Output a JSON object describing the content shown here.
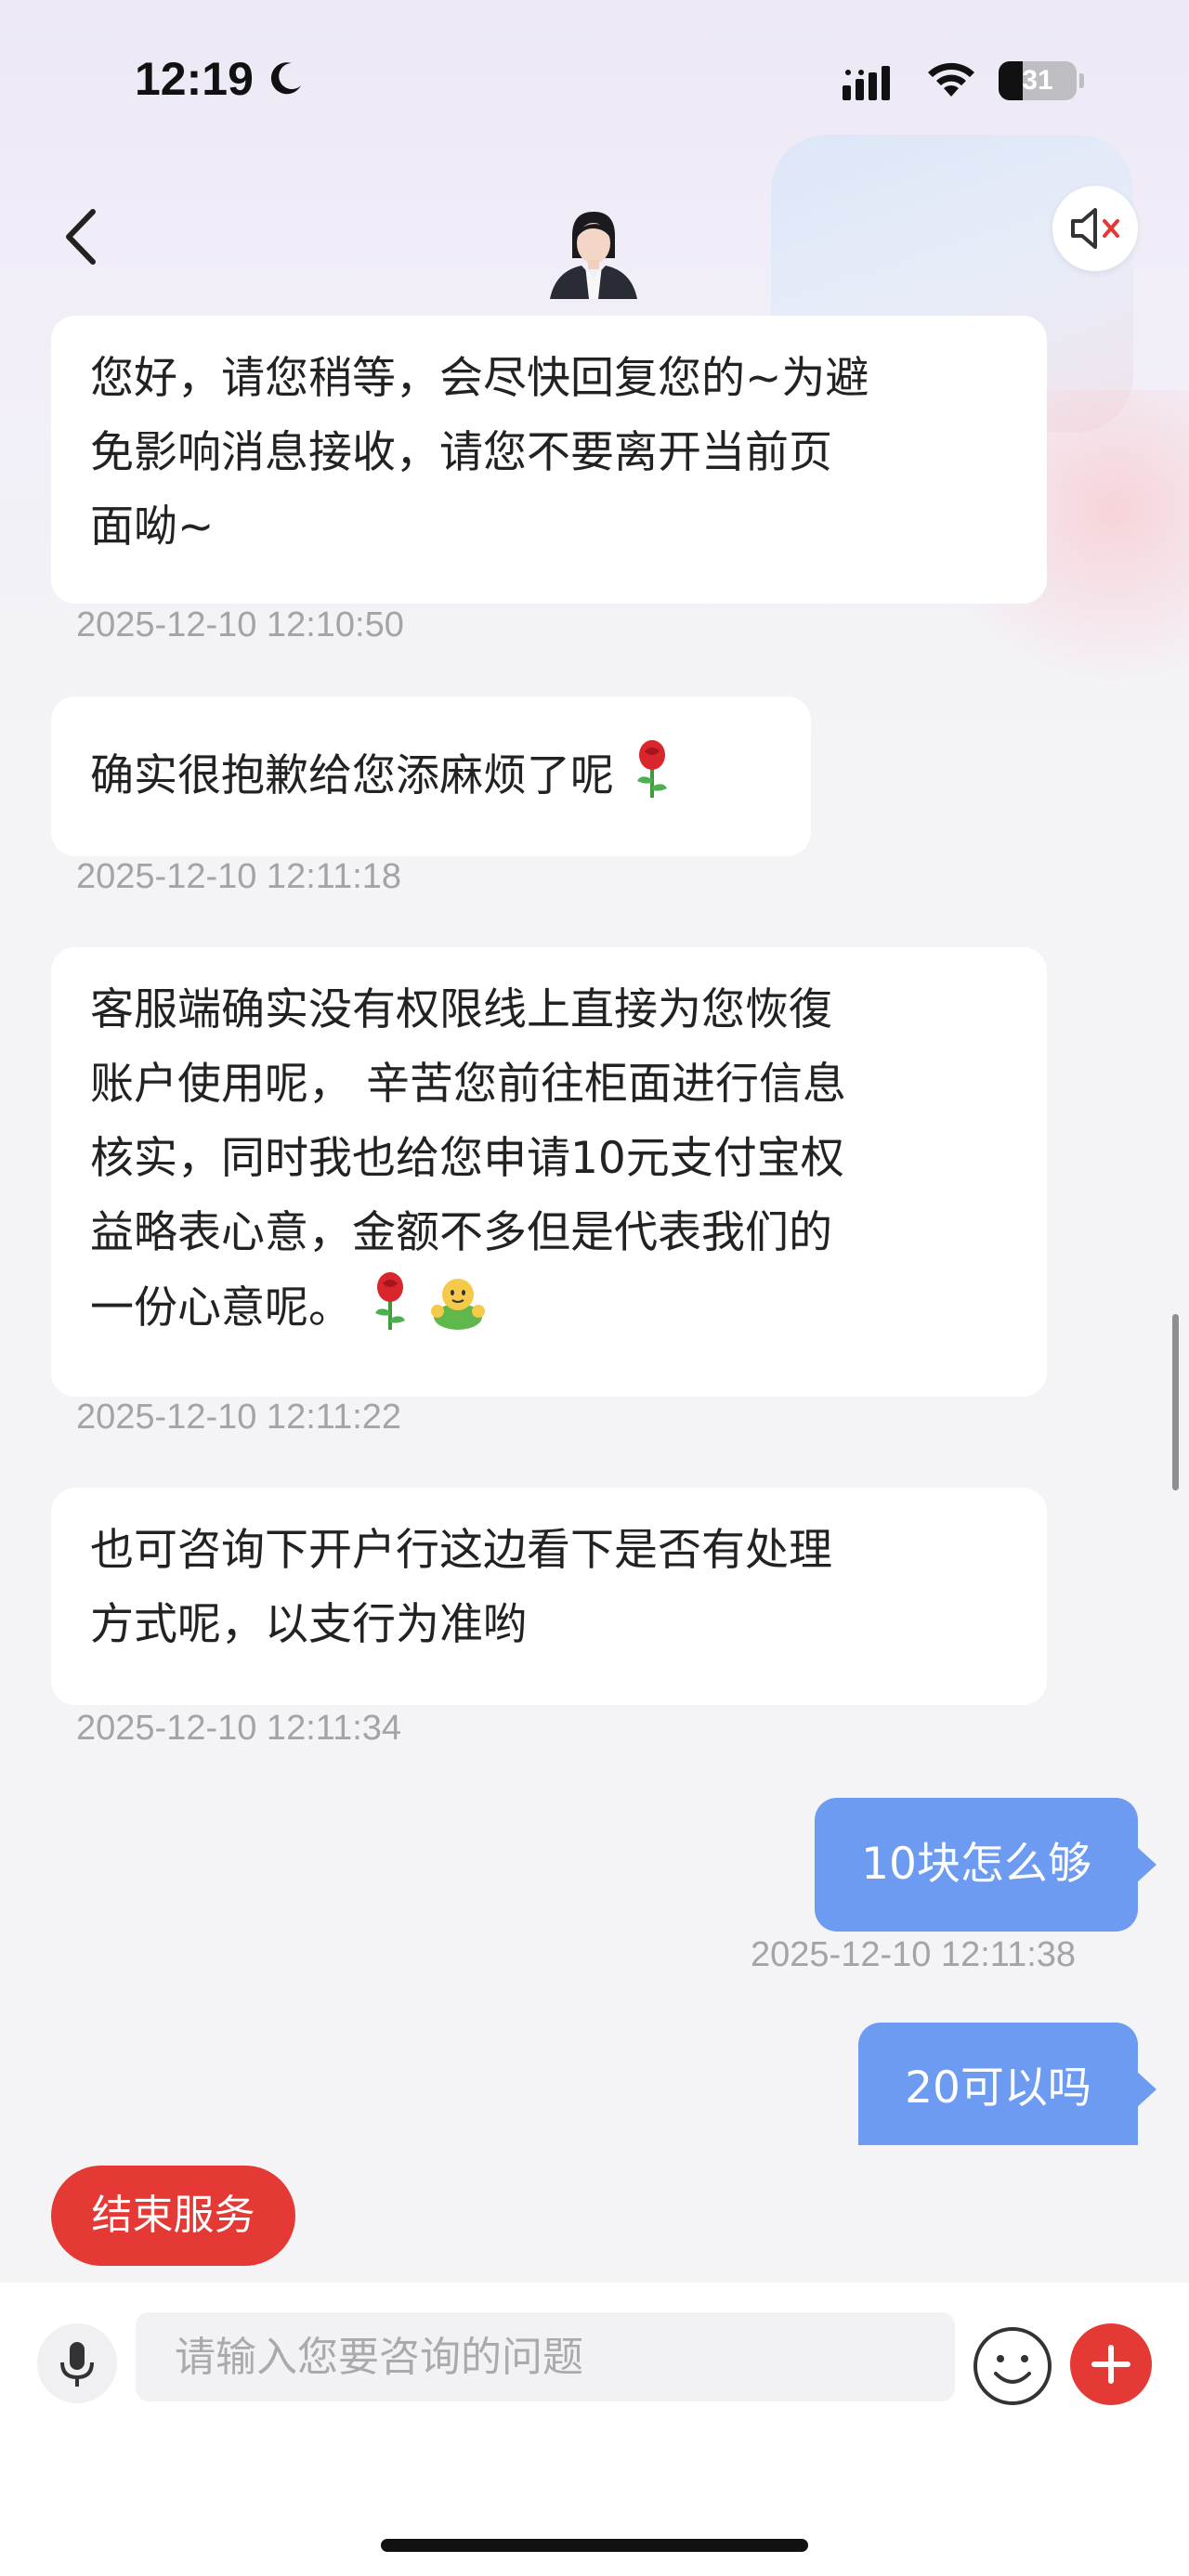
{
  "status_bar": {
    "time": "12:19",
    "battery": "31",
    "battery_level_percent": 31
  },
  "header": {
    "back_icon": "chevron-left-icon",
    "avatar_icon": "agent-avatar",
    "mute_icon": "speaker-muted-icon"
  },
  "messages": [
    {
      "side": "in",
      "lines": [
        "您好，请您稍等，会尽快回复您的~为避",
        "免影响消息接收，请您不要离开当前页",
        "面呦~"
      ],
      "time": "2025-12-10 12:10:50"
    },
    {
      "side": "in",
      "lines": [
        "确实很抱歉给您添麻烦了呢"
      ],
      "emoji": [
        "rose-emoji"
      ],
      "time": "2025-12-10 12:11:18"
    },
    {
      "side": "in",
      "lines": [
        "客服端确实没有权限线上直接为您恢復",
        "账户使用呢， 辛苦您前往柜面进行信息",
        "核实，同时我也给您申请10元支付宝权",
        "益略表心意，金额不多但是代表我们的",
        "一份心意呢。"
      ],
      "emoji": [
        "rose-emoji",
        "hug-emoji"
      ],
      "time": "2025-12-10 12:11:22"
    },
    {
      "side": "in",
      "lines": [
        "也可咨询下开户行这边看下是否有处理",
        "方式呢，以支行为准哟"
      ],
      "time": "2025-12-10 12:11:34"
    },
    {
      "side": "out",
      "text": "10块怎么够",
      "time": "2025-12-10 12:11:38"
    },
    {
      "side": "out",
      "text": "20可以吗"
    }
  ],
  "end_service_label": "结束服务",
  "input": {
    "placeholder": "请输入您要咨询的问题",
    "value": ""
  },
  "colors": {
    "accent_red": "#e53935",
    "outgoing_bubble": "#6d9bf2",
    "timestamp": "#a4a4a8"
  }
}
